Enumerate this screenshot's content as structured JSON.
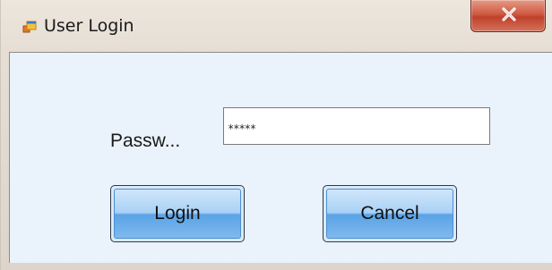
{
  "window": {
    "title": "User Login",
    "close_label": "X"
  },
  "form": {
    "password_label": "Passw...",
    "password_value": "*****"
  },
  "buttons": {
    "login_label": "Login",
    "cancel_label": "Cancel"
  },
  "icons": {
    "app_icon": "window-app-icon",
    "close_icon": "close-icon"
  },
  "colors": {
    "close_button": "#c0402a",
    "client_background": "#eaf2fb",
    "button_accent": "#5aa3e6"
  }
}
